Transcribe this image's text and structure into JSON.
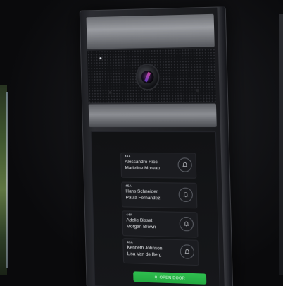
{
  "intercom": {
    "residents": [
      {
        "apartment": "46A",
        "names": [
          "Alessandro Ricci",
          "Madeline Moreau"
        ]
      },
      {
        "apartment": "45A",
        "names": [
          "Hans Schneider",
          "Paula Fernández"
        ]
      },
      {
        "apartment": "44A",
        "names": [
          "Adelie Bisset",
          "Morgan Brown"
        ]
      },
      {
        "apartment": "43A",
        "names": [
          "Kenneth Johnson",
          "Lisa Van de Berg"
        ]
      }
    ],
    "open_door_label": "OPEN DOOR",
    "colors": {
      "accent_green": "#2fbf4f",
      "screen_bg": "#111214",
      "card_bg": "#1b1c20"
    },
    "icons": {
      "call": "bell-icon",
      "door": "key-icon"
    }
  }
}
